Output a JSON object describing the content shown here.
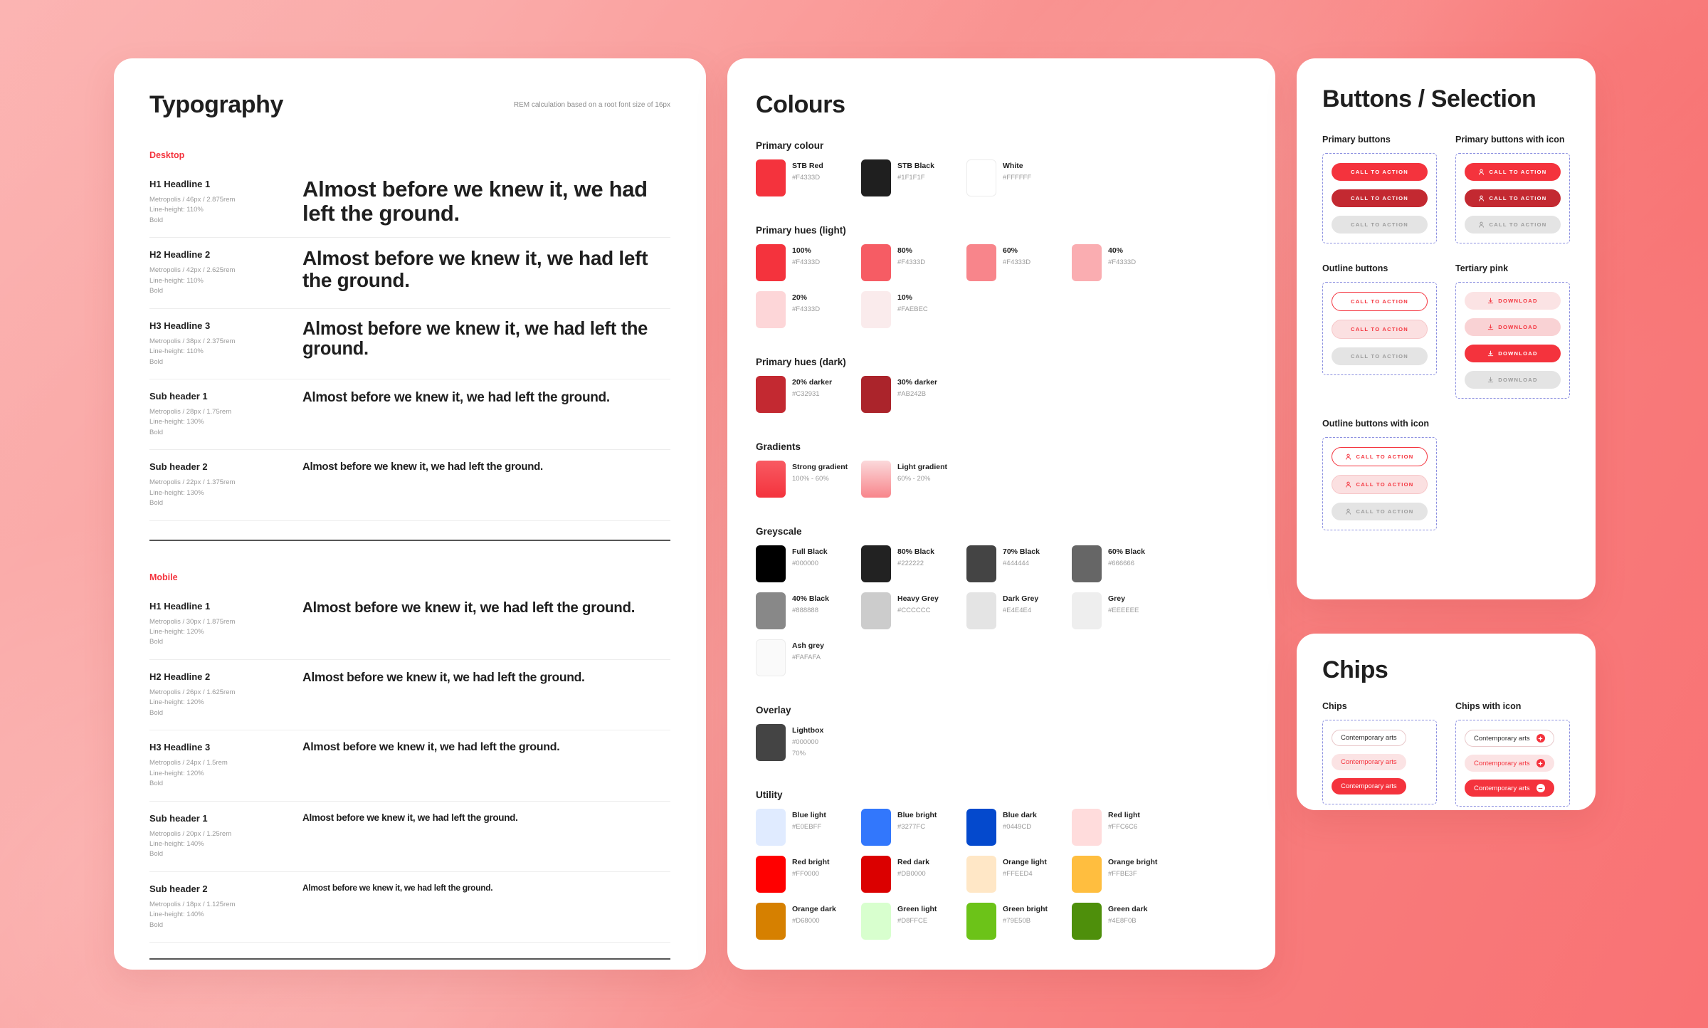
{
  "typography": {
    "title": "Typography",
    "rem_note": "REM calculation based on a root font size of 16px",
    "sections": [
      {
        "tag": "Desktop",
        "rows": [
          {
            "name": "H1 Headline 1",
            "spec_font": "Metropolis / 46px / 2.875rem",
            "spec_lh": "Line-height: 110%",
            "spec_weight": "Bold",
            "sample": "Almost before we knew it, we had left the ground.",
            "size": 31,
            "lh": 1.1
          },
          {
            "name": "H2 Headline 2",
            "spec_font": "Metropolis / 42px / 2.625rem",
            "spec_lh": "Line-height: 110%",
            "spec_weight": "Bold",
            "sample": "Almost before we knew it, we had left the ground.",
            "size": 28,
            "lh": 1.1
          },
          {
            "name": "H3 Headline 3",
            "spec_font": "Metropolis / 38px / 2.375rem",
            "spec_lh": "Line-height: 110%",
            "spec_weight": "Bold",
            "sample": "Almost before we knew it, we had left the ground.",
            "size": 25.5,
            "lh": 1.1
          },
          {
            "name": "Sub header 1",
            "spec_font": "Metropolis / 28px / 1.75rem",
            "spec_lh": "Line-height: 130%",
            "spec_weight": "Bold",
            "sample": "Almost before we knew it, we had left the ground.",
            "size": 19,
            "lh": 1.3
          },
          {
            "name": "Sub header 2",
            "spec_font": "Metropolis / 22px / 1.375rem",
            "spec_lh": "Line-height: 130%",
            "spec_weight": "Bold",
            "sample": "Almost before we knew it, we had left the ground.",
            "size": 15,
            "lh": 1.3
          }
        ]
      },
      {
        "tag": "Mobile",
        "rows": [
          {
            "name": "H1 Headline 1",
            "spec_font": "Metropolis / 30px / 1.875rem",
            "spec_lh": "Line-height: 120%",
            "spec_weight": "Bold",
            "sample": "Almost before we knew it, we had left the ground.",
            "size": 20.5,
            "lh": 1.2
          },
          {
            "name": "H2 Headline 2",
            "spec_font": "Metropolis / 26px / 1.625rem",
            "spec_lh": "Line-height: 120%",
            "spec_weight": "Bold",
            "sample": "Almost before we knew it, we had left the ground.",
            "size": 17.5,
            "lh": 1.2
          },
          {
            "name": "H3 Headline 3",
            "spec_font": "Metropolis / 24px / 1.5rem",
            "spec_lh": "Line-height: 120%",
            "spec_weight": "Bold",
            "sample": "Almost before we knew it, we had left the ground.",
            "size": 16,
            "lh": 1.2
          },
          {
            "name": "Sub header 1",
            "spec_font": "Metropolis / 20px / 1.25rem",
            "spec_lh": "Line-height: 140%",
            "spec_weight": "Bold",
            "sample": "Almost before we knew it, we had left the ground.",
            "size": 13.5,
            "lh": 1.4
          },
          {
            "name": "Sub header 2",
            "spec_font": "Metropolis / 18px / 1.125rem",
            "spec_lh": "Line-height: 140%",
            "spec_weight": "Bold",
            "sample": "Almost before we knew it, we had left the ground.",
            "size": 12,
            "lh": 1.4
          }
        ]
      }
    ]
  },
  "colours": {
    "title": "Colours",
    "groups": [
      {
        "title": "Primary colour",
        "swatches": [
          {
            "name": "STB Red",
            "hex": "#F4333D",
            "fill": "#F4333D"
          },
          {
            "name": "STB Black",
            "hex": "#1F1F1F",
            "fill": "#1F1F1F"
          },
          {
            "name": "White",
            "hex": "#FFFFFF",
            "fill": "#FFFFFF",
            "bordered": true
          }
        ]
      },
      {
        "title": "Primary hues (light)",
        "swatches": [
          {
            "name": "100%",
            "hex": "#F4333D",
            "fill": "#F4333D"
          },
          {
            "name": "80%",
            "hex": "#F4333D",
            "fill": "#F65C64"
          },
          {
            "name": "60%",
            "hex": "#F4333D",
            "fill": "#F8858B"
          },
          {
            "name": "40%",
            "hex": "#F4333D",
            "fill": "#FAADB1"
          },
          {
            "name": "20%",
            "hex": "#F4333D",
            "fill": "#FDD6D8"
          },
          {
            "name": "10%",
            "hex": "#FAEBEC",
            "fill": "#FAEBEC"
          }
        ]
      },
      {
        "title": "Primary hues (dark)",
        "swatches": [
          {
            "name": "20% darker",
            "hex": "#C32931",
            "fill": "#C32931"
          },
          {
            "name": "30% darker",
            "hex": "#AB242B",
            "fill": "#AB242B"
          }
        ]
      },
      {
        "title": "Gradients",
        "swatches": [
          {
            "name": "Strong gradient",
            "hex": "100% - 60%",
            "gradient": "linear-gradient(180deg,#F85A62 0%,#F4333D 100%)"
          },
          {
            "name": "Light gradient",
            "hex": "60% - 20%",
            "gradient": "linear-gradient(180deg,#FBD9DB 0%,#F8858B 100%)"
          }
        ]
      },
      {
        "title": "Greyscale",
        "swatches": [
          {
            "name": "Full Black",
            "hex": "#000000",
            "fill": "#000000"
          },
          {
            "name": "80% Black",
            "hex": "#222222",
            "fill": "#222222"
          },
          {
            "name": "70% Black",
            "hex": "#444444",
            "fill": "#444444"
          },
          {
            "name": "60% Black",
            "hex": "#666666",
            "fill": "#666666"
          },
          {
            "name": "40% Black",
            "hex": "#888888",
            "fill": "#888888"
          },
          {
            "name": "Heavy Grey",
            "hex": "#CCCCCC",
            "fill": "#CCCCCC"
          },
          {
            "name": "Dark Grey",
            "hex": "#E4E4E4",
            "fill": "#E4E4E4"
          },
          {
            "name": "Grey",
            "hex": "#EEEEEE",
            "fill": "#EEEEEE"
          },
          {
            "name": "Ash grey",
            "hex": "#FAFAFA",
            "fill": "#FAFAFA",
            "bordered": true
          }
        ]
      },
      {
        "title": "Overlay",
        "swatches": [
          {
            "name": "Lightbox",
            "hex": "#000000",
            "extra": "70%",
            "fill": "#444444"
          }
        ]
      },
      {
        "title": "Utility",
        "swatches": [
          {
            "name": "Blue light",
            "hex": "#E0EBFF",
            "fill": "#E0EBFF"
          },
          {
            "name": "Blue bright",
            "hex": "#3277FC",
            "fill": "#3277FC"
          },
          {
            "name": "Blue dark",
            "hex": "#0449CD",
            "fill": "#0449CD"
          },
          {
            "name": "Red light",
            "hex": "#FFC6C6",
            "fill": "#FFDCDC"
          },
          {
            "name": "Red bright",
            "hex": "#FF0000",
            "fill": "#FF0000"
          },
          {
            "name": "Red dark",
            "hex": "#DB0000",
            "fill": "#DB0000"
          },
          {
            "name": "Orange light",
            "hex": "#FFEED4",
            "fill": "#FFE7C6"
          },
          {
            "name": "Orange bright",
            "hex": "#FFBE3F",
            "fill": "#FFBE3F"
          },
          {
            "name": "Orange dark",
            "hex": "#D68000",
            "fill": "#D68000"
          },
          {
            "name": "Green light",
            "hex": "#D8FFCE",
            "fill": "#D8FFCE"
          },
          {
            "name": "Green bright",
            "hex": "#79E50B",
            "fill": "#6CC318"
          },
          {
            "name": "Green dark",
            "hex": "#4E8F0B",
            "fill": "#4E8F0B"
          }
        ]
      }
    ]
  },
  "buttons": {
    "title": "Buttons / Selection",
    "groups": [
      {
        "title": "Primary buttons",
        "labels": [
          "CALL TO ACTION",
          "CALL TO ACTION",
          "CALL TO ACTION"
        ]
      },
      {
        "title": "Primary buttons with icon",
        "labels": [
          "CALL TO ACTION",
          "CALL TO ACTION",
          "CALL TO ACTION"
        ],
        "icon": "person-icon"
      },
      {
        "title": "Outline buttons",
        "labels": [
          "CALL TO ACTION",
          "CALL TO ACTION",
          "CALL TO ACTION"
        ]
      },
      {
        "title": "Tertiary pink",
        "labels": [
          "DOWNLOAD",
          "DOWNLOAD",
          "DOWNLOAD",
          "DOWNLOAD"
        ],
        "icon": "download-icon"
      },
      {
        "title": "Outline buttons with icon",
        "labels": [
          "CALL TO ACTION",
          "CALL TO ACTION",
          "CALL TO ACTION"
        ],
        "icon": "person-icon"
      }
    ]
  },
  "chips": {
    "title": "Chips",
    "groups": [
      {
        "title": "Chips",
        "labels": [
          "Contemporary arts",
          "Contemporary arts",
          "Contemporary arts"
        ]
      },
      {
        "title": "Chips with icon",
        "labels": [
          "Contemporary arts",
          "Contemporary arts",
          "Contemporary arts"
        ],
        "icons": [
          "plus-icon",
          "plus-icon",
          "minus-icon"
        ]
      }
    ]
  }
}
